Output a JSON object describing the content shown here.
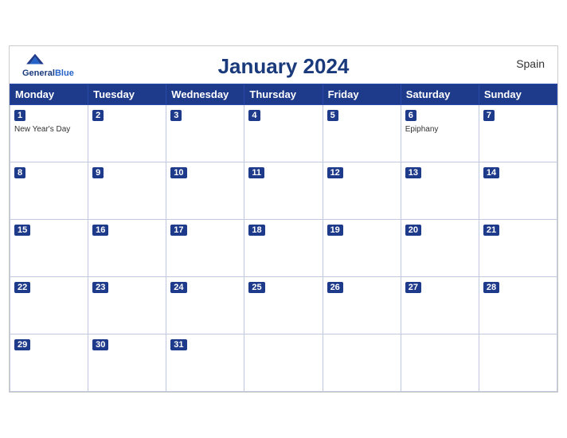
{
  "header": {
    "title": "January 2024",
    "country": "Spain",
    "logo_general": "General",
    "logo_blue": "Blue"
  },
  "weekdays": [
    "Monday",
    "Tuesday",
    "Wednesday",
    "Thursday",
    "Friday",
    "Saturday",
    "Sunday"
  ],
  "weeks": [
    [
      {
        "day": 1,
        "holiday": "New Year's Day"
      },
      {
        "day": 2
      },
      {
        "day": 3
      },
      {
        "day": 4
      },
      {
        "day": 5
      },
      {
        "day": 6,
        "holiday": "Epiphany"
      },
      {
        "day": 7
      }
    ],
    [
      {
        "day": 8
      },
      {
        "day": 9
      },
      {
        "day": 10
      },
      {
        "day": 11
      },
      {
        "day": 12
      },
      {
        "day": 13
      },
      {
        "day": 14
      }
    ],
    [
      {
        "day": 15
      },
      {
        "day": 16
      },
      {
        "day": 17
      },
      {
        "day": 18
      },
      {
        "day": 19
      },
      {
        "day": 20
      },
      {
        "day": 21
      }
    ],
    [
      {
        "day": 22
      },
      {
        "day": 23
      },
      {
        "day": 24
      },
      {
        "day": 25
      },
      {
        "day": 26
      },
      {
        "day": 27
      },
      {
        "day": 28
      }
    ],
    [
      {
        "day": 29
      },
      {
        "day": 30
      },
      {
        "day": 31
      },
      {
        "day": null
      },
      {
        "day": null
      },
      {
        "day": null
      },
      {
        "day": null
      }
    ]
  ]
}
